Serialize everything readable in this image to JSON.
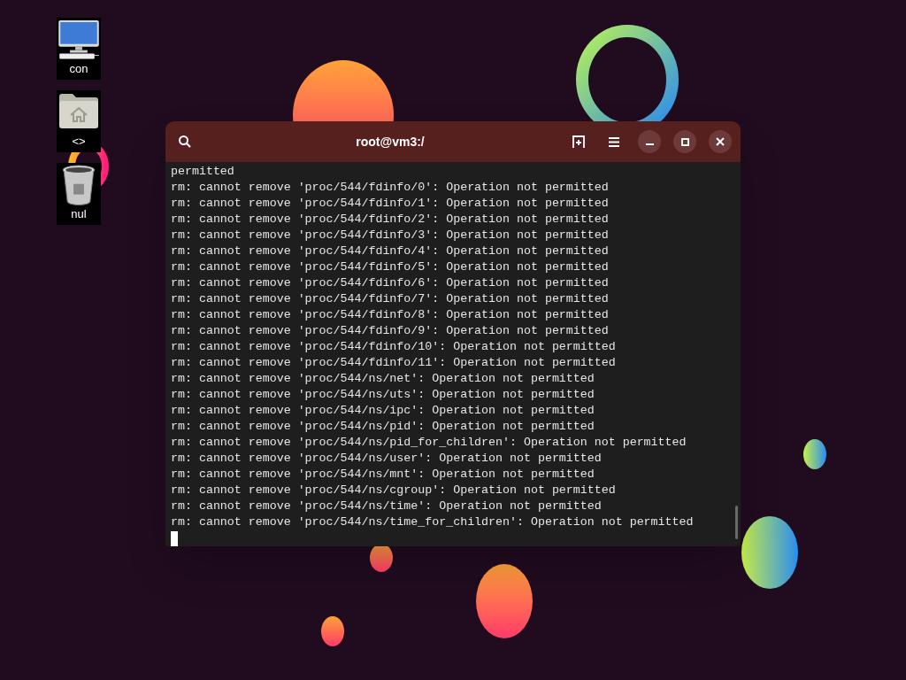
{
  "desktop_icons": [
    {
      "kind": "computer",
      "label": "con"
    },
    {
      "kind": "home-folder",
      "label": "<>"
    },
    {
      "kind": "trash",
      "label": "nul"
    }
  ],
  "window": {
    "title": "root@vm3:/"
  },
  "terminal": {
    "lines": [
      "permitted",
      "rm: cannot remove 'proc/544/fdinfo/0': Operation not permitted",
      "rm: cannot remove 'proc/544/fdinfo/1': Operation not permitted",
      "rm: cannot remove 'proc/544/fdinfo/2': Operation not permitted",
      "rm: cannot remove 'proc/544/fdinfo/3': Operation not permitted",
      "rm: cannot remove 'proc/544/fdinfo/4': Operation not permitted",
      "rm: cannot remove 'proc/544/fdinfo/5': Operation not permitted",
      "rm: cannot remove 'proc/544/fdinfo/6': Operation not permitted",
      "rm: cannot remove 'proc/544/fdinfo/7': Operation not permitted",
      "rm: cannot remove 'proc/544/fdinfo/8': Operation not permitted",
      "rm: cannot remove 'proc/544/fdinfo/9': Operation not permitted",
      "rm: cannot remove 'proc/544/fdinfo/10': Operation not permitted",
      "rm: cannot remove 'proc/544/fdinfo/11': Operation not permitted",
      "rm: cannot remove 'proc/544/ns/net': Operation not permitted",
      "rm: cannot remove 'proc/544/ns/uts': Operation not permitted",
      "rm: cannot remove 'proc/544/ns/ipc': Operation not permitted",
      "rm: cannot remove 'proc/544/ns/pid': Operation not permitted",
      "rm: cannot remove 'proc/544/ns/pid_for_children': Operation not permitted",
      "rm: cannot remove 'proc/544/ns/user': Operation not permitted",
      "rm: cannot remove 'proc/544/ns/mnt': Operation not permitted",
      "rm: cannot remove 'proc/544/ns/cgroup': Operation not permitted",
      "rm: cannot remove 'proc/544/ns/time': Operation not permitted",
      "rm: cannot remove 'proc/544/ns/time_for_children': Operation not permitted"
    ]
  }
}
